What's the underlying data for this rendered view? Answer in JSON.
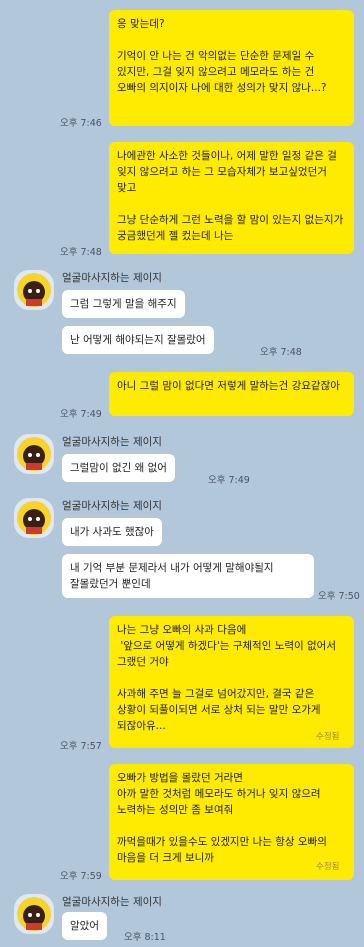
{
  "sender_name": "얼굴마사지하는 제이지",
  "edited_label": "수정됨",
  "messages": [
    {
      "who": "me",
      "text": "응 맞는데?\n\n기억이 안 나는 건 악의없는 단순한 문제일 수 있지만, 그걸 잊지 않으려고 메모라도 하는 건 오빠의 의지이자 나에 대한 성의가 맞지 않나...?",
      "time": "오후 7:46"
    },
    {
      "who": "me",
      "text": "나에관한 사소한 것들이나, 어제 말한 일정 같은 걸 잊지 않으려고 하는 그 모습자체가 보고싶었던거 맞고\n\n그냥 단순하게 그런 노력을 할 맘이 있는지 없는지가 궁금했던게 젤 컸는데 나는",
      "time": "오후 7:48"
    },
    {
      "who": "other",
      "text": "그럼 그렇게 말을 해주지"
    },
    {
      "who": "other",
      "text": "난 어떻게 해야되는지 잘몰랐어",
      "time": "오후 7:48"
    },
    {
      "who": "me",
      "text": "아니 그럴 맘이 없다면 저렇게 말하는건 강요같잖아",
      "time": "오후 7:49"
    },
    {
      "who": "other",
      "text": "그럴맘이 없긴 왜 없어",
      "time": "오후 7:49"
    },
    {
      "who": "other",
      "text": "내가 사과도 했잖아"
    },
    {
      "who": "other",
      "text": "내 기억 부분 문제라서 내가 어떻게 말해야될지 잘몰랐던거 뿐인데",
      "time": "오후 7:50"
    },
    {
      "who": "me",
      "text": "나는 그냥 오빠의 사과 다음에\n '앞으로 어떻게 하겠다'는 구체적인 노력이 없어서 그랬던 거야\n\n사과해 주면 늘 그걸로 넘어갔지만, 결국 같은 상황이 되풀이되면 서로 상처 되는 말만 오가게 되잖아유...",
      "time": "오후 7:57",
      "edited": true
    },
    {
      "who": "me",
      "text": "오빠가 방법을 몰랐던 거라면\n아까 말한 것처럼 메모라도 하거나 잊지 않으려 노력하는 성의만 좀 보여줘\n\n까먹을때가 있을수도 있겠지만 나는 항상 오빠의 마음을 더 크게 보니까",
      "time": "오후 7:59",
      "edited": true
    },
    {
      "who": "other",
      "text": "알았어",
      "time": "오후 8:11"
    }
  ]
}
